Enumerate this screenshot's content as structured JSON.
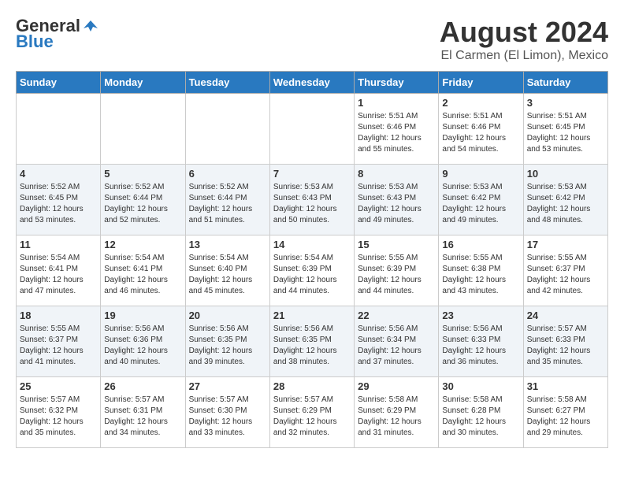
{
  "header": {
    "logo_general": "General",
    "logo_blue": "Blue",
    "month": "August 2024",
    "location": "El Carmen (El Limon), Mexico"
  },
  "weekdays": [
    "Sunday",
    "Monday",
    "Tuesday",
    "Wednesday",
    "Thursday",
    "Friday",
    "Saturday"
  ],
  "weeks": [
    [
      {
        "day": "",
        "info": ""
      },
      {
        "day": "",
        "info": ""
      },
      {
        "day": "",
        "info": ""
      },
      {
        "day": "",
        "info": ""
      },
      {
        "day": "1",
        "info": "Sunrise: 5:51 AM\nSunset: 6:46 PM\nDaylight: 12 hours\nand 55 minutes."
      },
      {
        "day": "2",
        "info": "Sunrise: 5:51 AM\nSunset: 6:46 PM\nDaylight: 12 hours\nand 54 minutes."
      },
      {
        "day": "3",
        "info": "Sunrise: 5:51 AM\nSunset: 6:45 PM\nDaylight: 12 hours\nand 53 minutes."
      }
    ],
    [
      {
        "day": "4",
        "info": "Sunrise: 5:52 AM\nSunset: 6:45 PM\nDaylight: 12 hours\nand 53 minutes."
      },
      {
        "day": "5",
        "info": "Sunrise: 5:52 AM\nSunset: 6:44 PM\nDaylight: 12 hours\nand 52 minutes."
      },
      {
        "day": "6",
        "info": "Sunrise: 5:52 AM\nSunset: 6:44 PM\nDaylight: 12 hours\nand 51 minutes."
      },
      {
        "day": "7",
        "info": "Sunrise: 5:53 AM\nSunset: 6:43 PM\nDaylight: 12 hours\nand 50 minutes."
      },
      {
        "day": "8",
        "info": "Sunrise: 5:53 AM\nSunset: 6:43 PM\nDaylight: 12 hours\nand 49 minutes."
      },
      {
        "day": "9",
        "info": "Sunrise: 5:53 AM\nSunset: 6:42 PM\nDaylight: 12 hours\nand 49 minutes."
      },
      {
        "day": "10",
        "info": "Sunrise: 5:53 AM\nSunset: 6:42 PM\nDaylight: 12 hours\nand 48 minutes."
      }
    ],
    [
      {
        "day": "11",
        "info": "Sunrise: 5:54 AM\nSunset: 6:41 PM\nDaylight: 12 hours\nand 47 minutes."
      },
      {
        "day": "12",
        "info": "Sunrise: 5:54 AM\nSunset: 6:41 PM\nDaylight: 12 hours\nand 46 minutes."
      },
      {
        "day": "13",
        "info": "Sunrise: 5:54 AM\nSunset: 6:40 PM\nDaylight: 12 hours\nand 45 minutes."
      },
      {
        "day": "14",
        "info": "Sunrise: 5:54 AM\nSunset: 6:39 PM\nDaylight: 12 hours\nand 44 minutes."
      },
      {
        "day": "15",
        "info": "Sunrise: 5:55 AM\nSunset: 6:39 PM\nDaylight: 12 hours\nand 44 minutes."
      },
      {
        "day": "16",
        "info": "Sunrise: 5:55 AM\nSunset: 6:38 PM\nDaylight: 12 hours\nand 43 minutes."
      },
      {
        "day": "17",
        "info": "Sunrise: 5:55 AM\nSunset: 6:37 PM\nDaylight: 12 hours\nand 42 minutes."
      }
    ],
    [
      {
        "day": "18",
        "info": "Sunrise: 5:55 AM\nSunset: 6:37 PM\nDaylight: 12 hours\nand 41 minutes."
      },
      {
        "day": "19",
        "info": "Sunrise: 5:56 AM\nSunset: 6:36 PM\nDaylight: 12 hours\nand 40 minutes."
      },
      {
        "day": "20",
        "info": "Sunrise: 5:56 AM\nSunset: 6:35 PM\nDaylight: 12 hours\nand 39 minutes."
      },
      {
        "day": "21",
        "info": "Sunrise: 5:56 AM\nSunset: 6:35 PM\nDaylight: 12 hours\nand 38 minutes."
      },
      {
        "day": "22",
        "info": "Sunrise: 5:56 AM\nSunset: 6:34 PM\nDaylight: 12 hours\nand 37 minutes."
      },
      {
        "day": "23",
        "info": "Sunrise: 5:56 AM\nSunset: 6:33 PM\nDaylight: 12 hours\nand 36 minutes."
      },
      {
        "day": "24",
        "info": "Sunrise: 5:57 AM\nSunset: 6:33 PM\nDaylight: 12 hours\nand 35 minutes."
      }
    ],
    [
      {
        "day": "25",
        "info": "Sunrise: 5:57 AM\nSunset: 6:32 PM\nDaylight: 12 hours\nand 35 minutes."
      },
      {
        "day": "26",
        "info": "Sunrise: 5:57 AM\nSunset: 6:31 PM\nDaylight: 12 hours\nand 34 minutes."
      },
      {
        "day": "27",
        "info": "Sunrise: 5:57 AM\nSunset: 6:30 PM\nDaylight: 12 hours\nand 33 minutes."
      },
      {
        "day": "28",
        "info": "Sunrise: 5:57 AM\nSunset: 6:29 PM\nDaylight: 12 hours\nand 32 minutes."
      },
      {
        "day": "29",
        "info": "Sunrise: 5:58 AM\nSunset: 6:29 PM\nDaylight: 12 hours\nand 31 minutes."
      },
      {
        "day": "30",
        "info": "Sunrise: 5:58 AM\nSunset: 6:28 PM\nDaylight: 12 hours\nand 30 minutes."
      },
      {
        "day": "31",
        "info": "Sunrise: 5:58 AM\nSunset: 6:27 PM\nDaylight: 12 hours\nand 29 minutes."
      }
    ]
  ]
}
